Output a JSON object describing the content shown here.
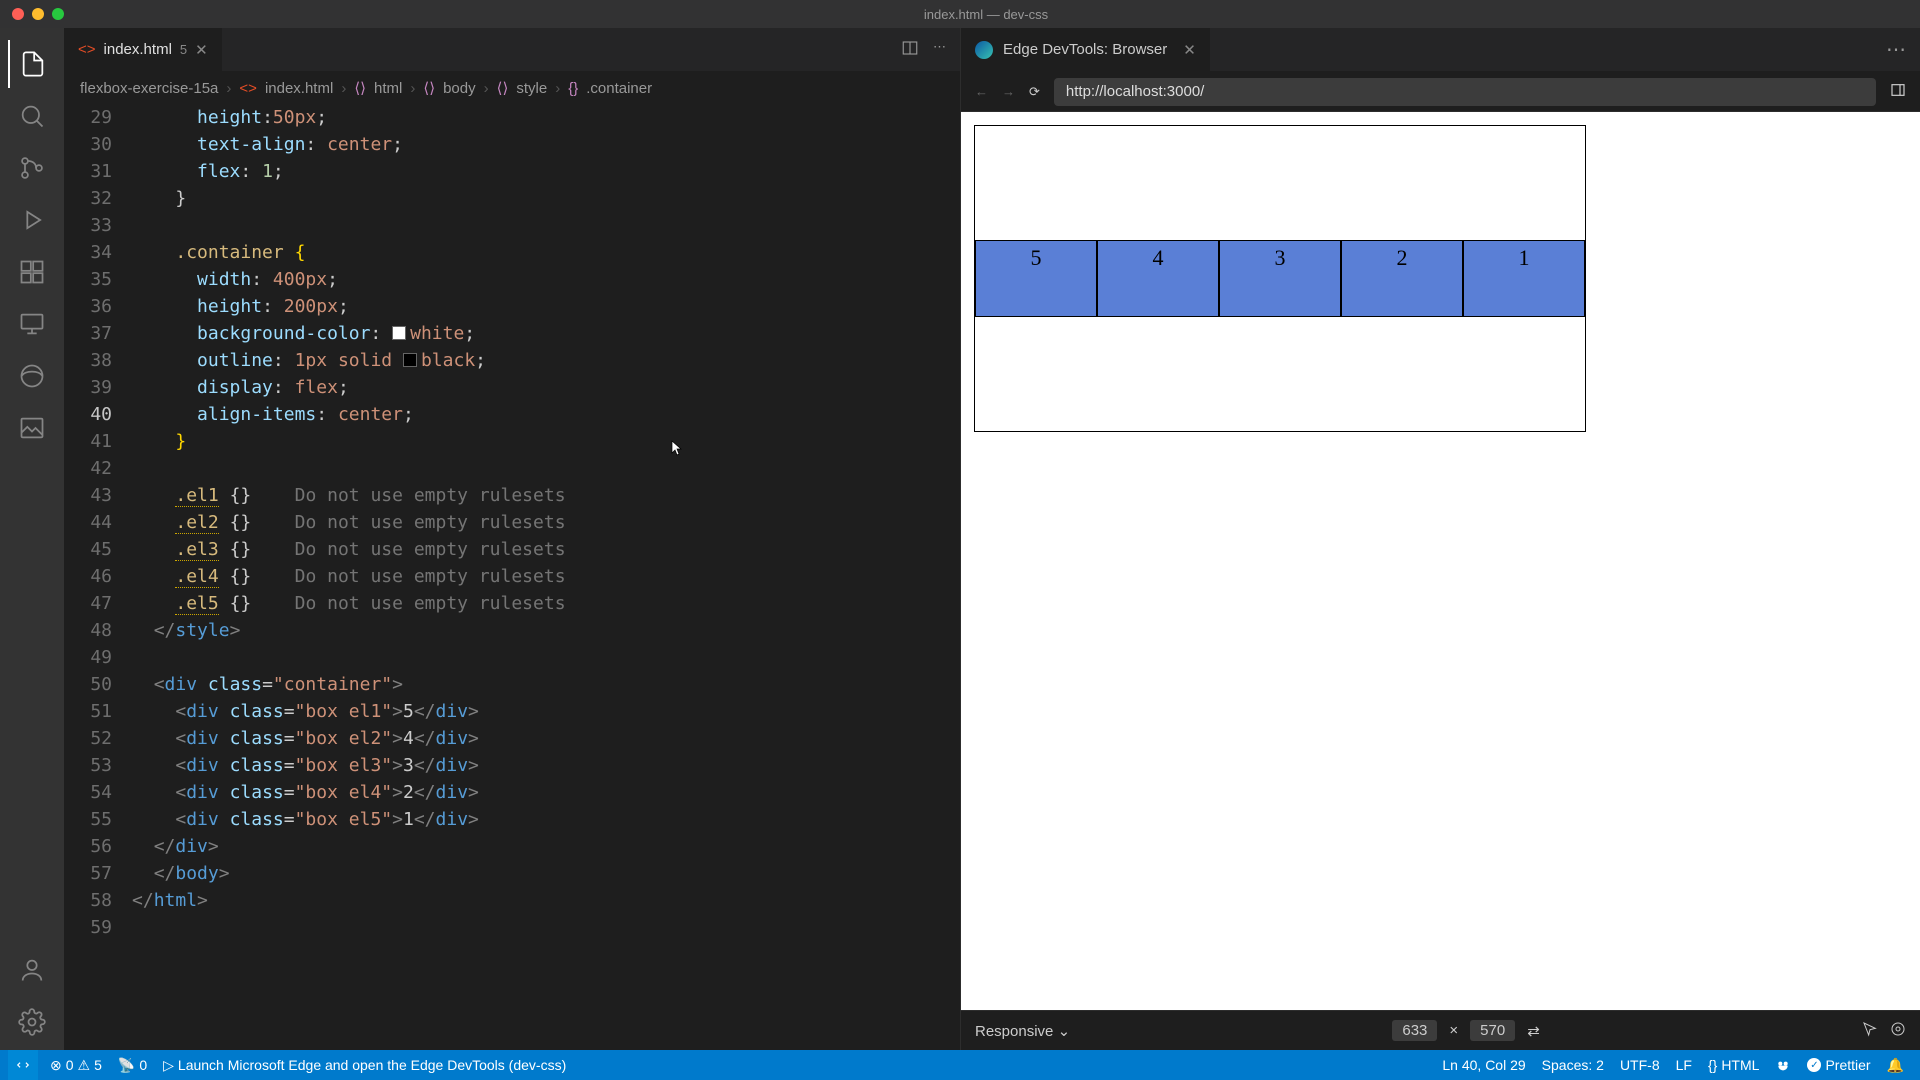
{
  "titlebar": {
    "title": "index.html — dev-css"
  },
  "tab": {
    "filename": "index.html",
    "dirty_badge": "5"
  },
  "breadcrumb": {
    "root": "flexbox-exercise-15a",
    "file": "index.html",
    "path": [
      "html",
      "body",
      "style",
      ".container"
    ]
  },
  "code": {
    "lines": [
      {
        "n": 29,
        "indent": 3,
        "type": "decl",
        "prop": "height",
        "colon_tight": true,
        "val": "50px",
        "semi": true
      },
      {
        "n": 30,
        "indent": 3,
        "type": "decl",
        "prop": "text-align",
        "val": "center",
        "semi": true
      },
      {
        "n": 31,
        "indent": 3,
        "type": "decl",
        "prop": "flex",
        "val_num": "1",
        "semi": true
      },
      {
        "n": 32,
        "indent": 2,
        "type": "close_brace"
      },
      {
        "n": 33,
        "indent": 0,
        "type": "blank"
      },
      {
        "n": 34,
        "indent": 2,
        "type": "selector",
        "sel": ".container",
        "open": true
      },
      {
        "n": 35,
        "indent": 3,
        "type": "decl",
        "prop": "width",
        "val": "400px",
        "semi": true
      },
      {
        "n": 36,
        "indent": 3,
        "type": "decl",
        "prop": "height",
        "val": "200px",
        "semi": true
      },
      {
        "n": 37,
        "indent": 3,
        "type": "decl",
        "prop": "background-color",
        "swatch": "sw-white",
        "val": "white",
        "semi": true
      },
      {
        "n": 38,
        "indent": 3,
        "type": "decl",
        "prop": "outline",
        "val_compound": [
          "1px",
          "solid"
        ],
        "swatch": "sw-black",
        "val": "black",
        "semi": true
      },
      {
        "n": 39,
        "indent": 3,
        "type": "decl",
        "prop": "display",
        "val": "flex",
        "semi": true
      },
      {
        "n": 40,
        "indent": 3,
        "type": "decl",
        "prop": "align-items",
        "val": "center",
        "semi": true,
        "active": true
      },
      {
        "n": 41,
        "indent": 2,
        "type": "close_brace_hl"
      },
      {
        "n": 42,
        "indent": 0,
        "type": "blank"
      },
      {
        "n": 43,
        "indent": 2,
        "type": "empty_rule",
        "sel": ".el1",
        "warn": "Do not use empty rulesets"
      },
      {
        "n": 44,
        "indent": 2,
        "type": "empty_rule",
        "sel": ".el2",
        "warn": "Do not use empty rulesets"
      },
      {
        "n": 45,
        "indent": 2,
        "type": "empty_rule",
        "sel": ".el3",
        "warn": "Do not use empty rulesets"
      },
      {
        "n": 46,
        "indent": 2,
        "type": "empty_rule",
        "sel": ".el4",
        "warn": "Do not use empty rulesets"
      },
      {
        "n": 47,
        "indent": 2,
        "type": "empty_rule",
        "sel": ".el5",
        "warn": "Do not use empty rulesets"
      },
      {
        "n": 48,
        "indent": 1,
        "type": "close_tag",
        "tag": "style"
      },
      {
        "n": 49,
        "indent": 0,
        "type": "blank"
      },
      {
        "n": 50,
        "indent": 1,
        "type": "open_tag",
        "tag": "div",
        "attr": "class",
        "str": "container"
      },
      {
        "n": 51,
        "indent": 2,
        "type": "el_tag",
        "tag": "div",
        "attr": "class",
        "str": "box el1",
        "text": "5"
      },
      {
        "n": 52,
        "indent": 2,
        "type": "el_tag",
        "tag": "div",
        "attr": "class",
        "str": "box el2",
        "text": "4"
      },
      {
        "n": 53,
        "indent": 2,
        "type": "el_tag",
        "tag": "div",
        "attr": "class",
        "str": "box el3",
        "text": "3"
      },
      {
        "n": 54,
        "indent": 2,
        "type": "el_tag",
        "tag": "div",
        "attr": "class",
        "str": "box el4",
        "text": "2"
      },
      {
        "n": 55,
        "indent": 2,
        "type": "el_tag",
        "tag": "div",
        "attr": "class",
        "str": "box el5",
        "text": "1"
      },
      {
        "n": 56,
        "indent": 1,
        "type": "close_tag",
        "tag": "div"
      },
      {
        "n": 57,
        "indent": 0,
        "type": "close_tag",
        "tag": "body",
        "pre_indent": 1
      },
      {
        "n": 58,
        "indent": 0,
        "type": "close_tag",
        "tag": "html"
      },
      {
        "n": 59,
        "indent": 0,
        "type": "blank"
      }
    ]
  },
  "preview": {
    "tab_title": "Edge DevTools: Browser",
    "url": "http://localhost:3000/",
    "boxes": [
      "5",
      "4",
      "3",
      "2",
      "1"
    ],
    "footer": {
      "mode": "Responsive",
      "w": "633",
      "sep": "×",
      "h": "570"
    }
  },
  "status": {
    "errors": "0",
    "warnings": "5",
    "ports": "0",
    "launch": "Launch Microsoft Edge and open the Edge DevTools (dev-css)",
    "cursor": "Ln 40, Col 29",
    "spaces": "Spaces: 2",
    "encoding": "UTF-8",
    "eol": "LF",
    "lang": "HTML",
    "prettier": "Prettier"
  }
}
